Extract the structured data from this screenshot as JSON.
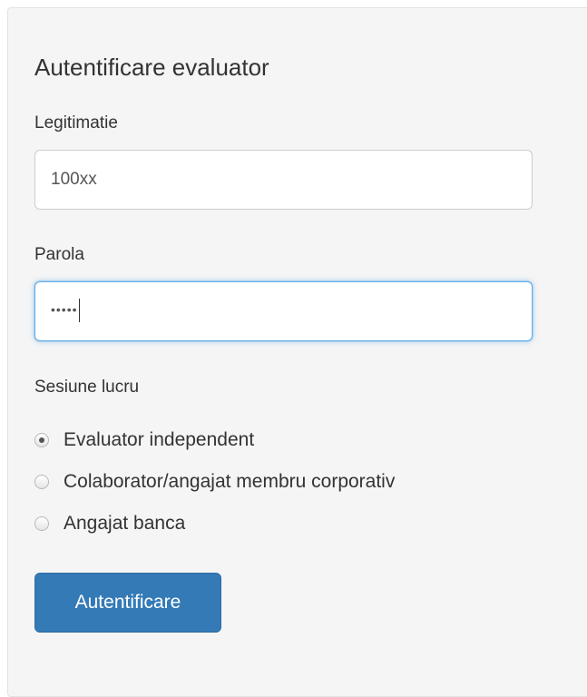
{
  "form": {
    "title": "Autentificare evaluator",
    "legitimatie_label": "Legitimatie",
    "legitimatie_value": "100xx",
    "parola_label": "Parola",
    "parola_masked": "•••••",
    "sesiune_label": "Sesiune lucru",
    "options": [
      {
        "label": "Evaluator independent",
        "selected": true
      },
      {
        "label": "Colaborator/angajat membru corporativ",
        "selected": false
      },
      {
        "label": "Angajat banca",
        "selected": false
      }
    ],
    "submit_label": "Autentificare"
  },
  "colors": {
    "panel_bg": "#f5f5f5",
    "primary": "#337ab7",
    "focus": "#66afe9"
  }
}
